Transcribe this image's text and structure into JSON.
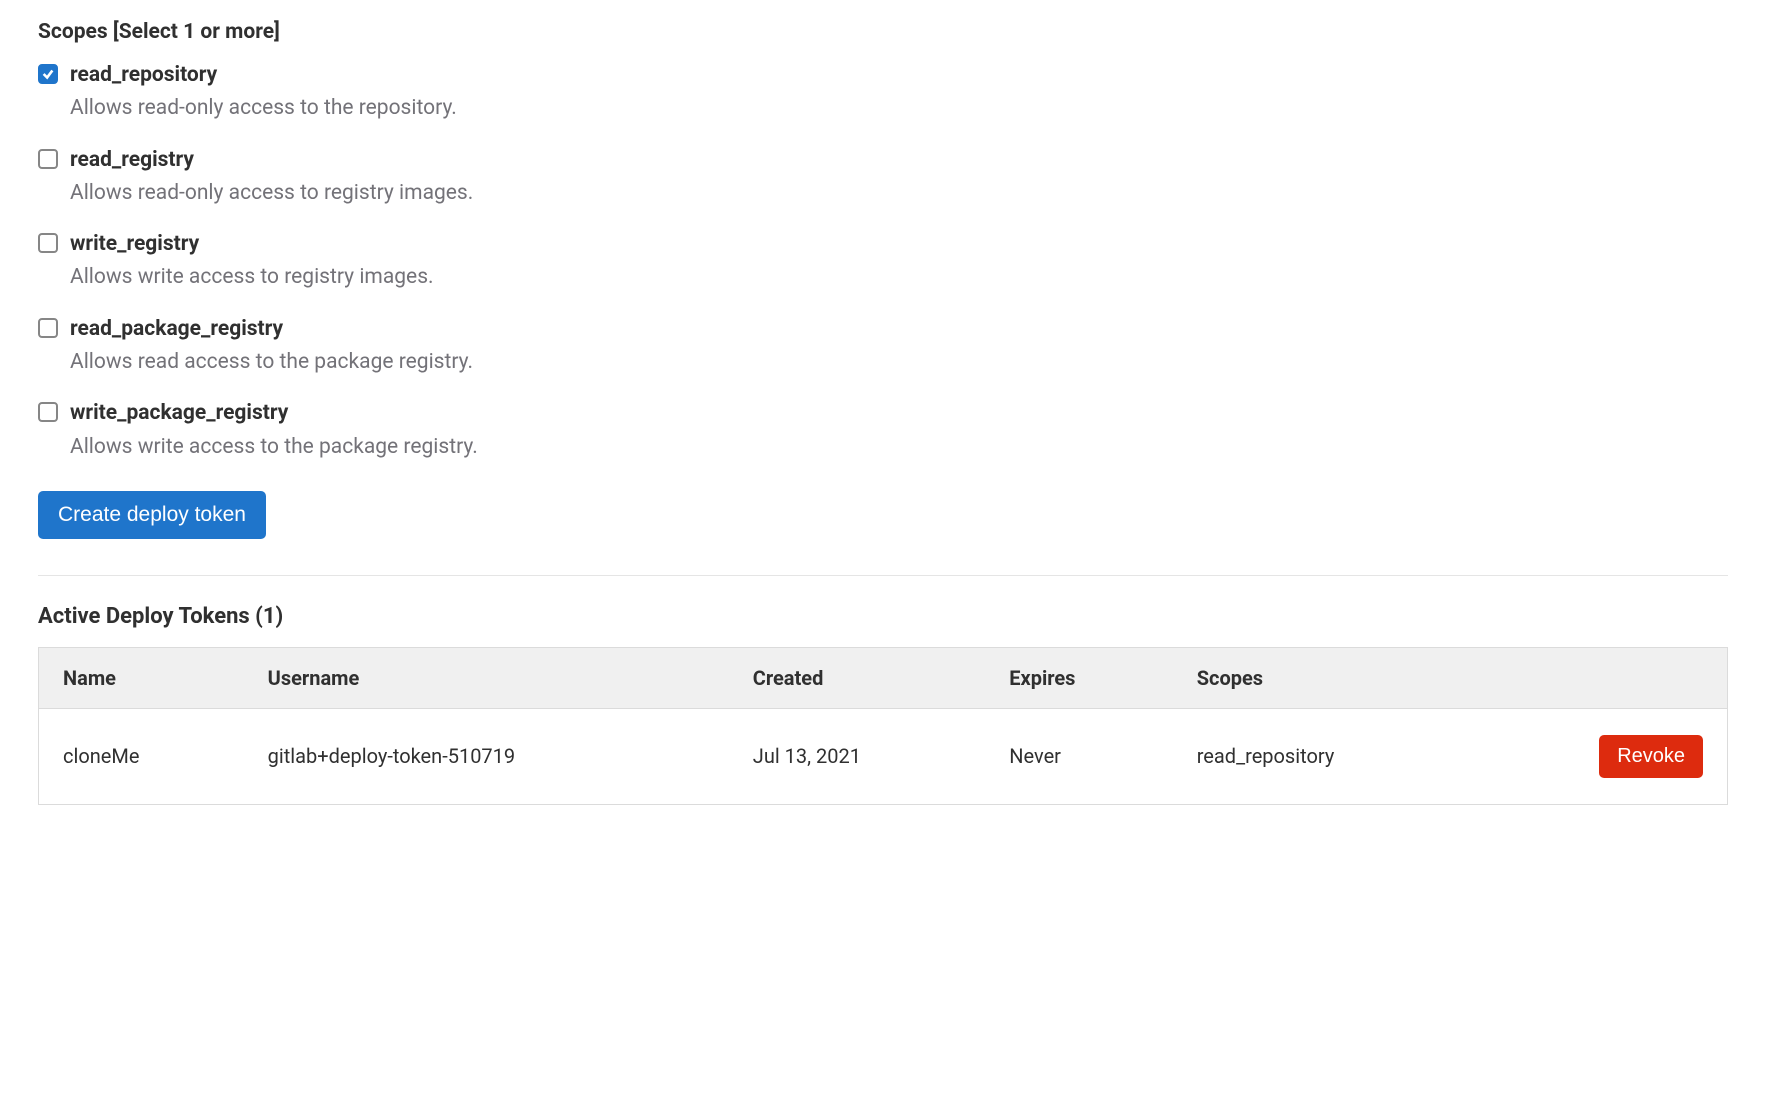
{
  "scopes_heading": "Scopes [Select 1 or more]",
  "scopes": [
    {
      "label": "read_repository",
      "desc": "Allows read-only access to the repository.",
      "checked": true
    },
    {
      "label": "read_registry",
      "desc": "Allows read-only access to registry images.",
      "checked": false
    },
    {
      "label": "write_registry",
      "desc": "Allows write access to registry images.",
      "checked": false
    },
    {
      "label": "read_package_registry",
      "desc": "Allows read access to the package registry.",
      "checked": false
    },
    {
      "label": "write_package_registry",
      "desc": "Allows write access to the package registry.",
      "checked": false
    }
  ],
  "create_button_label": "Create deploy token",
  "active_heading": "Active Deploy Tokens (1)",
  "table": {
    "headers": {
      "name": "Name",
      "username": "Username",
      "created": "Created",
      "expires": "Expires",
      "scopes": "Scopes"
    },
    "rows": [
      {
        "name": "cloneMe",
        "username": "gitlab+deploy-token-510719",
        "created": "Jul 13, 2021",
        "expires": "Never",
        "scopes": "read_repository",
        "action_label": "Revoke"
      }
    ]
  }
}
